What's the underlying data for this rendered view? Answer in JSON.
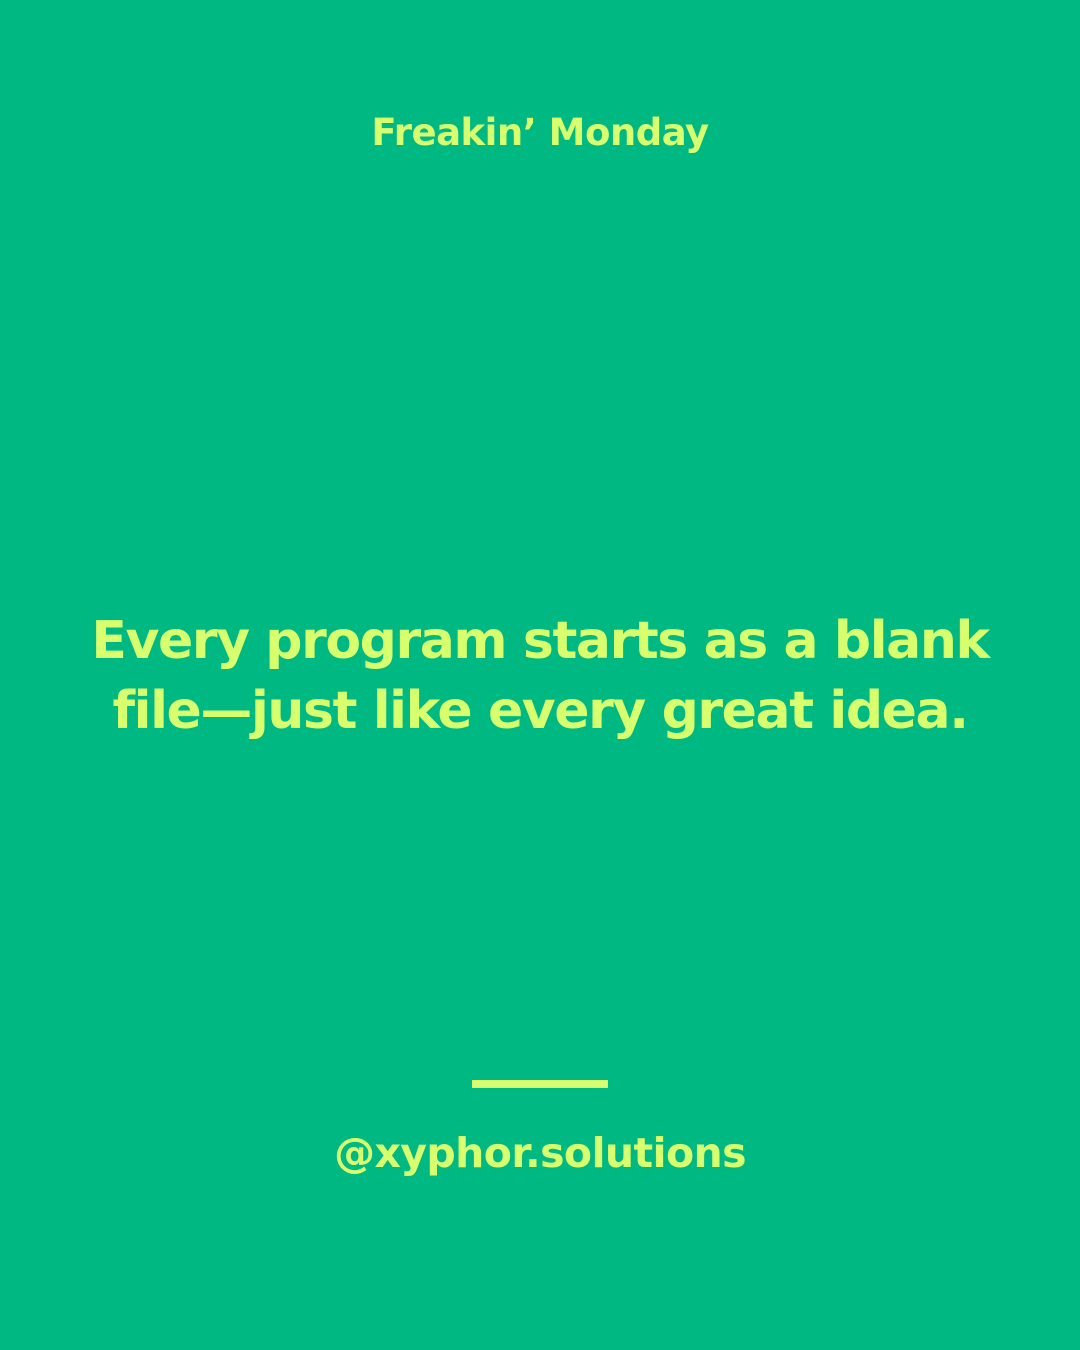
{
  "colors": {
    "background": "#00B982",
    "accent": "#D8FF6E"
  },
  "header": {
    "title": "Freakin’ Monday"
  },
  "quote": {
    "line1": "Every program starts as a blank",
    "line2": "file—just like every great idea."
  },
  "footer": {
    "handle": "@xyphor.solutions"
  }
}
